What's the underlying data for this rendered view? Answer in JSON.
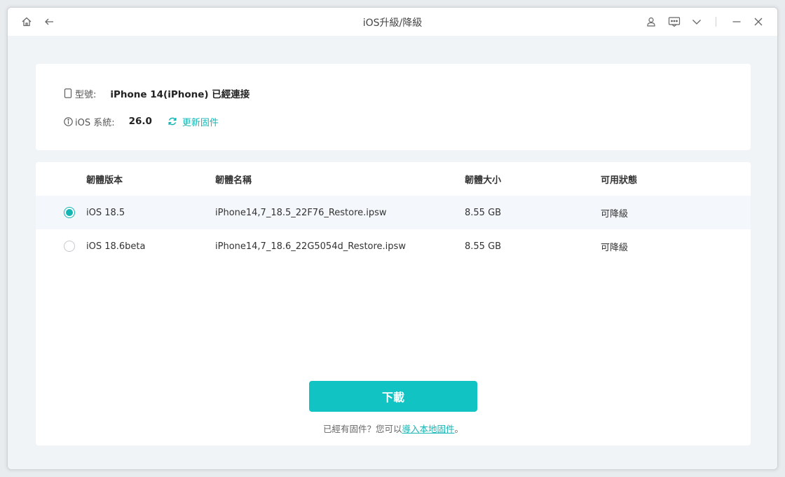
{
  "window": {
    "title": "iOS升級/降級"
  },
  "device": {
    "model_label": "型號:",
    "model_value": "iPhone 14(iPhone) 已經連接",
    "ios_label": "iOS 系統:",
    "ios_value": "26.0",
    "update_firmware_label": "更新固件"
  },
  "firmware_table": {
    "headers": [
      "韌體版本",
      "韌體名稱",
      "韌體大小",
      "可用狀態"
    ],
    "rows": [
      {
        "version": "iOS 18.5",
        "name": "iPhone14,7_18.5_22F76_Restore.ipsw",
        "size": "8.55 GB",
        "status": "可降級",
        "selected": true
      },
      {
        "version": "iOS 18.6beta",
        "name": "iPhone14,7_18.6_22G5054d_Restore.ipsw",
        "size": "8.55 GB",
        "status": "可降級",
        "selected": false
      }
    ]
  },
  "actions": {
    "download_label": "下載",
    "footer_prefix": "已經有固件？您可以",
    "import_link_label": "導入本地固件",
    "footer_suffix": "。"
  },
  "icons": {
    "home": "home-icon",
    "back": "back-arrow-icon",
    "user": "user-icon",
    "feedback": "feedback-icon",
    "menu": "chevron-down-icon",
    "minimize": "minimize-icon",
    "close": "close-icon",
    "phone": "phone-icon",
    "info": "info-icon",
    "refresh": "refresh-icon"
  },
  "colors": {
    "accent": "#11c3c3",
    "link": "#14b5b5"
  }
}
